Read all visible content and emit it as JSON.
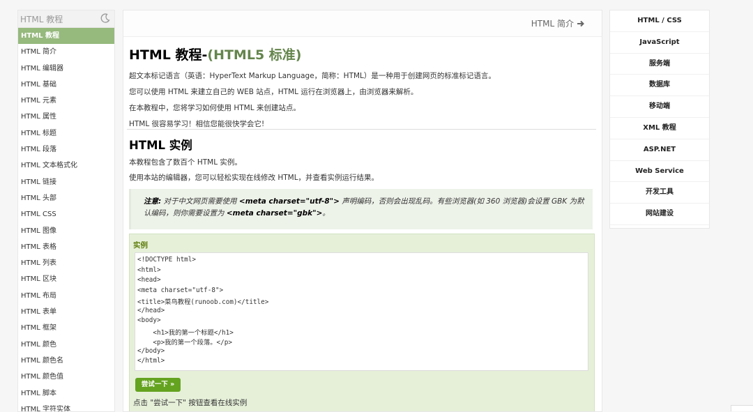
{
  "left_sidebar": {
    "search_placeholder": "HTML 教程",
    "items": [
      {
        "label": "HTML 教程",
        "active": true
      },
      {
        "label": "HTML 简介"
      },
      {
        "label": "HTML 编辑器"
      },
      {
        "label": "HTML 基础"
      },
      {
        "label": "HTML 元素"
      },
      {
        "label": "HTML 属性"
      },
      {
        "label": "HTML 标题"
      },
      {
        "label": "HTML 段落"
      },
      {
        "label": "HTML 文本格式化"
      },
      {
        "label": "HTML 链接"
      },
      {
        "label": "HTML 头部"
      },
      {
        "label": "HTML CSS"
      },
      {
        "label": "HTML 图像"
      },
      {
        "label": "HTML 表格"
      },
      {
        "label": "HTML 列表"
      },
      {
        "label": "HTML 区块"
      },
      {
        "label": "HTML 布局"
      },
      {
        "label": "HTML 表单"
      },
      {
        "label": "HTML 框架"
      },
      {
        "label": "HTML 颜色"
      },
      {
        "label": "HTML 颜色名"
      },
      {
        "label": "HTML 颜色值"
      },
      {
        "label": "HTML 脚本"
      },
      {
        "label": "HTML 字符实体"
      }
    ]
  },
  "main": {
    "next_link": "HTML 简介",
    "title": "HTML 教程-",
    "title_sub": "(HTML5 标准)",
    "intro": [
      "超文本标记语言（英语：HyperText Markup Language，简称：HTML）是一种用于创建网页的标准标记语言。",
      "您可以使用 HTML 来建立自己的 WEB 站点，HTML 运行在浏览器上，由浏览器来解析。",
      "在本教程中，您将学习如何使用 HTML 来创建站点。",
      "HTML 很容易学习！相信您能很快学会它!"
    ],
    "section_title": "HTML 实例",
    "section_lines": [
      "本教程包含了数百个 HTML 实例。",
      "使用本站的编辑器，您可以轻松实现在线修改 HTML，并查看实例运行结果。"
    ],
    "note": {
      "label": "注意:",
      "text1": "对于中文网页需要使用",
      "code1": "<meta charset=\"utf-8\">",
      "text2": "声明编码，否则会出现乱码。有些浏览器(如 360 浏览器)会设置 GBK 为默认编码，则你需要设置为",
      "code2": "<meta charset=\"gbk\">",
      "text3": "。"
    },
    "example": {
      "label": "实例",
      "code_lines": [
        "<!DOCTYPE html>",
        "<html>",
        "<head>",
        "<meta charset=\"utf-8\">",
        "<title>菜鸟教程(runoob.com)</title>",
        "</head>",
        "<body>",
        "    <h1>我的第一个标题</h1>",
        "    <p>我的第一个段落。</p>",
        "</body>",
        "</html>"
      ],
      "try_button": "尝试一下 »",
      "hint": "点击 \"尝试一下\" 按钮查看在线实例"
    }
  },
  "right_sidebar": {
    "items": [
      "HTML / CSS",
      "JavaScript",
      "服务端",
      "数据库",
      "移动端",
      "XML 教程",
      "ASP.NET",
      "Web Service",
      "开发工具",
      "网站建设"
    ]
  },
  "colors": {
    "active_nav": "#96b97d",
    "title_accent": "#64854c",
    "try_button": "#64a31f",
    "example_bg": "#e6f0d9"
  }
}
